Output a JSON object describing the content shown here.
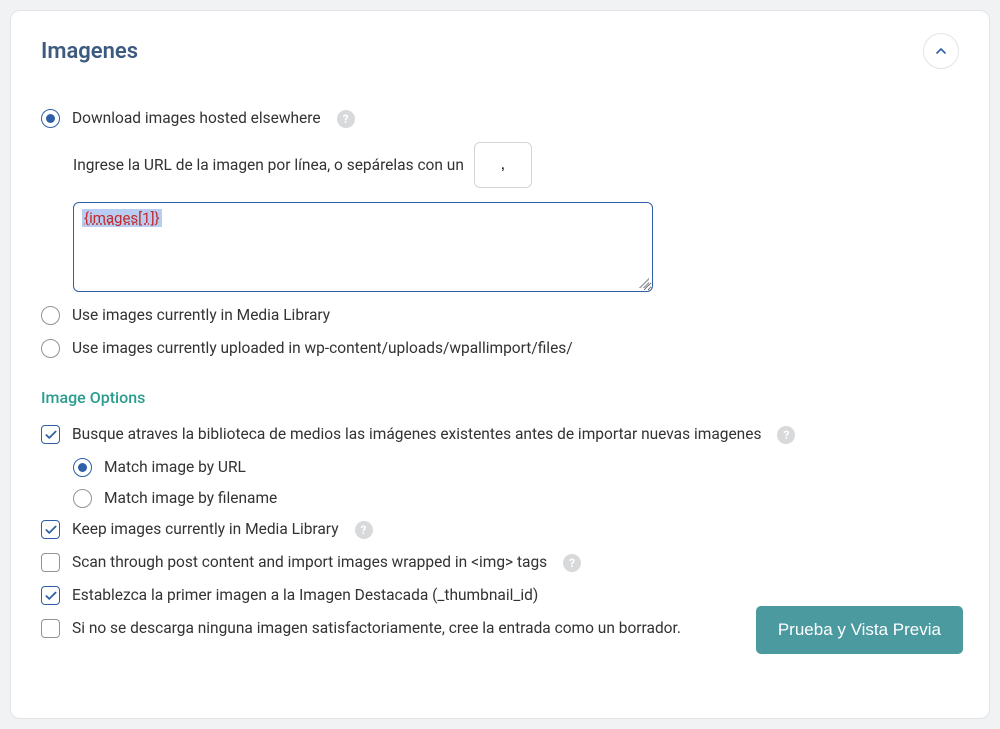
{
  "panel": {
    "title": "Imagenes"
  },
  "source": {
    "download": {
      "label": "Download images hosted elsewhere"
    },
    "urlLine": {
      "prefix": "Ingrese la URL de la imagen por línea, o sepárelas con un",
      "separator": ","
    },
    "textarea": {
      "value": "{images[1]}"
    },
    "mediaLibrary": {
      "label": "Use images currently in Media Library"
    },
    "uploadsDir": {
      "label": "Use images currently uploaded in wp-content/uploads/wpallimport/files/"
    }
  },
  "options": {
    "title": "Image Options",
    "searchExisting": {
      "label": "Busque atraves la biblioteca de medios las imágenes existentes antes de importar nuevas imagenes"
    },
    "matchByUrl": {
      "label": "Match image by URL"
    },
    "matchByFilename": {
      "label": "Match image by filename"
    },
    "keepCurrent": {
      "label": "Keep images currently in Media Library"
    },
    "scanImgTags": {
      "label": "Scan through post content and import images wrapped in <img> tags"
    },
    "setFeatured": {
      "label": "Establezca la primer imagen a la Imagen Destacada (_thumbnail_id)"
    },
    "draftOnFail": {
      "label": "Si no se descarga ninguna imagen satisfactoriamente, cree la entrada como un borrador."
    }
  },
  "footer": {
    "previewBtn": "Prueba y Vista Previa"
  },
  "icons": {
    "help": "?"
  }
}
